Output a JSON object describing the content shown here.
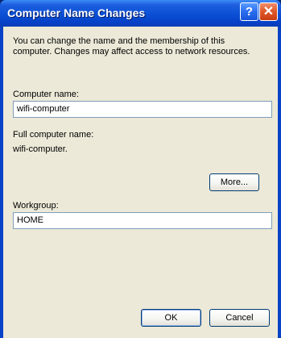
{
  "window": {
    "title": "Computer Name Changes",
    "help_glyph": "?",
    "close_glyph": "✕"
  },
  "description": {
    "line1": "You can change the name and the membership of this",
    "line2": "computer. Changes may affect access to network resources."
  },
  "computer_name": {
    "label": "Computer name:",
    "value": "wifi-computer"
  },
  "full_name": {
    "label": "Full computer name:",
    "value": "wifi-computer."
  },
  "more_button": "More...",
  "workgroup": {
    "label": "Workgroup:",
    "value": "HOME"
  },
  "ok_button": "OK",
  "cancel_button": "Cancel",
  "colors": {
    "titlebar": "#0a4fd4",
    "client": "#ece9d8",
    "input_border": "#7f9db9",
    "button_border": "#003c74"
  }
}
